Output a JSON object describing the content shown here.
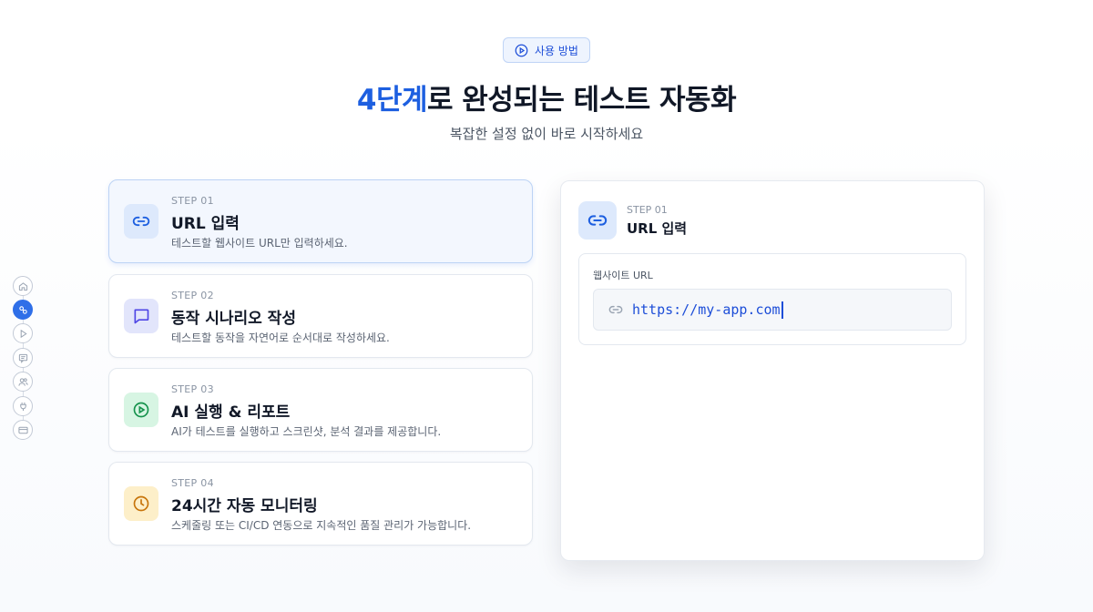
{
  "header": {
    "badge_label": "사용 방법",
    "title_highlight": "4단계",
    "title_rest": "로 완성되는 테스트 자동화",
    "subtitle": "복잡한 설정 없이 바로 시작하세요"
  },
  "rail": {
    "items": [
      {
        "icon": "home-icon",
        "active": false
      },
      {
        "icon": "link-icon",
        "active": true
      },
      {
        "icon": "play-icon",
        "active": false
      },
      {
        "icon": "message-icon",
        "active": false
      },
      {
        "icon": "users-icon",
        "active": false
      },
      {
        "icon": "plug-icon",
        "active": false
      },
      {
        "icon": "card-icon",
        "active": false
      }
    ]
  },
  "steps": [
    {
      "num": "STEP 01",
      "title": "URL 입력",
      "desc": "테스트할 웹사이트 URL만 입력하세요.",
      "icon": "link-icon",
      "active": true
    },
    {
      "num": "STEP 02",
      "title": "동작 시나리오 작성",
      "desc": "테스트할 동작을 자연어로 순서대로 작성하세요.",
      "icon": "message-icon",
      "active": false
    },
    {
      "num": "STEP 03",
      "title": "AI 실행 & 리포트",
      "desc": "AI가 테스트를 실행하고 스크린샷, 분석 결과를 제공합니다.",
      "icon": "play-circle-icon",
      "active": false
    },
    {
      "num": "STEP 04",
      "title": "24시간 자동 모니터링",
      "desc": "스케줄링 또는 CI/CD 연동으로 지속적인 품질 관리가 가능합니다.",
      "icon": "clock-icon",
      "active": false
    }
  ],
  "panel": {
    "step": "STEP 01",
    "title": "URL 입력",
    "field_label": "웹사이트 URL",
    "url_value": "https://my-app.com"
  },
  "colors": {
    "accent": "#1d5fe0",
    "step2": "#4f46e5",
    "step3": "#15924c",
    "step4": "#c7740a"
  }
}
